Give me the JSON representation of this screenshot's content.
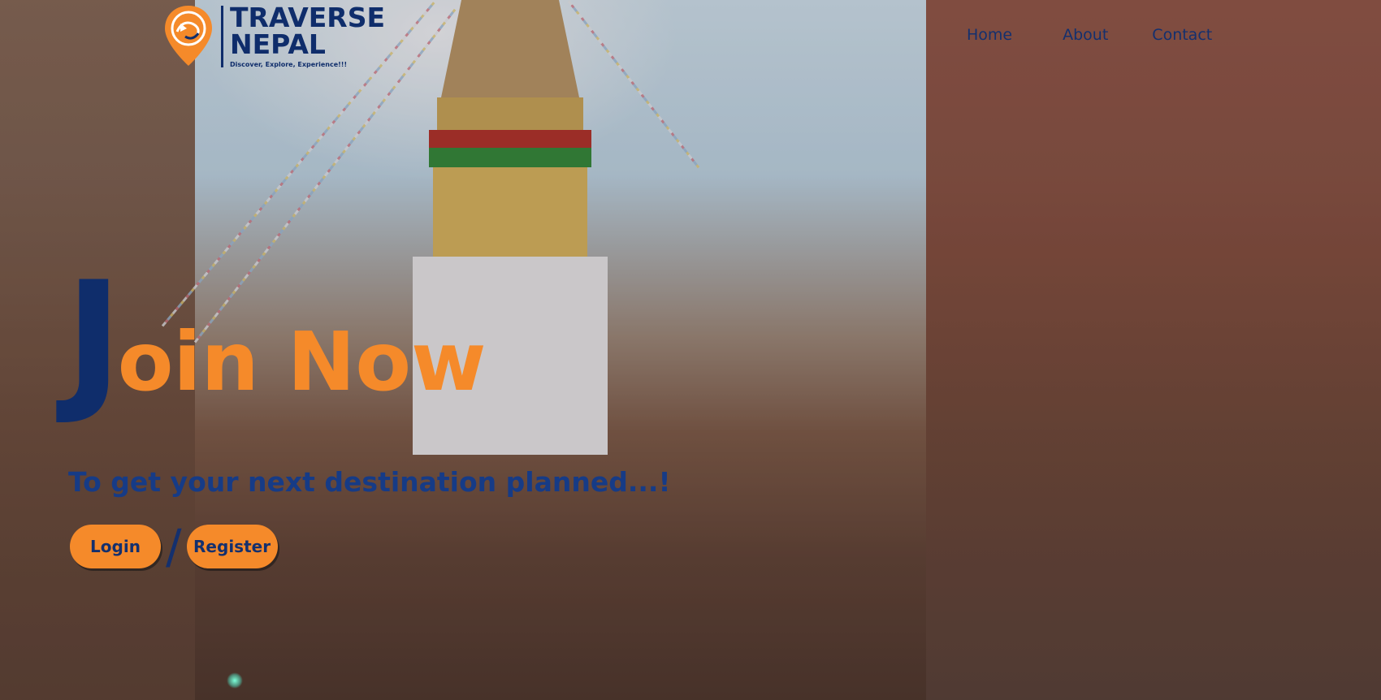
{
  "brand": {
    "name": "TRAVERSE NEPAL",
    "name_line1": "TRAVERSE",
    "name_line2": "NEPAL",
    "tagline": "Discover, Explore, Experience!!!"
  },
  "nav": {
    "items": [
      {
        "label": "Home"
      },
      {
        "label": "About"
      },
      {
        "label": "Contact"
      }
    ]
  },
  "hero": {
    "title_initial": "J",
    "title_rest": "oin Now",
    "subtitle": "To get your next destination planned...!",
    "separator": "/",
    "login_label": "Login",
    "register_label": "Register"
  },
  "colors": {
    "navy": "#0f2d6b",
    "orange": "#f58a2a"
  },
  "icons": {
    "logo": "map-pin-logo-icon"
  }
}
